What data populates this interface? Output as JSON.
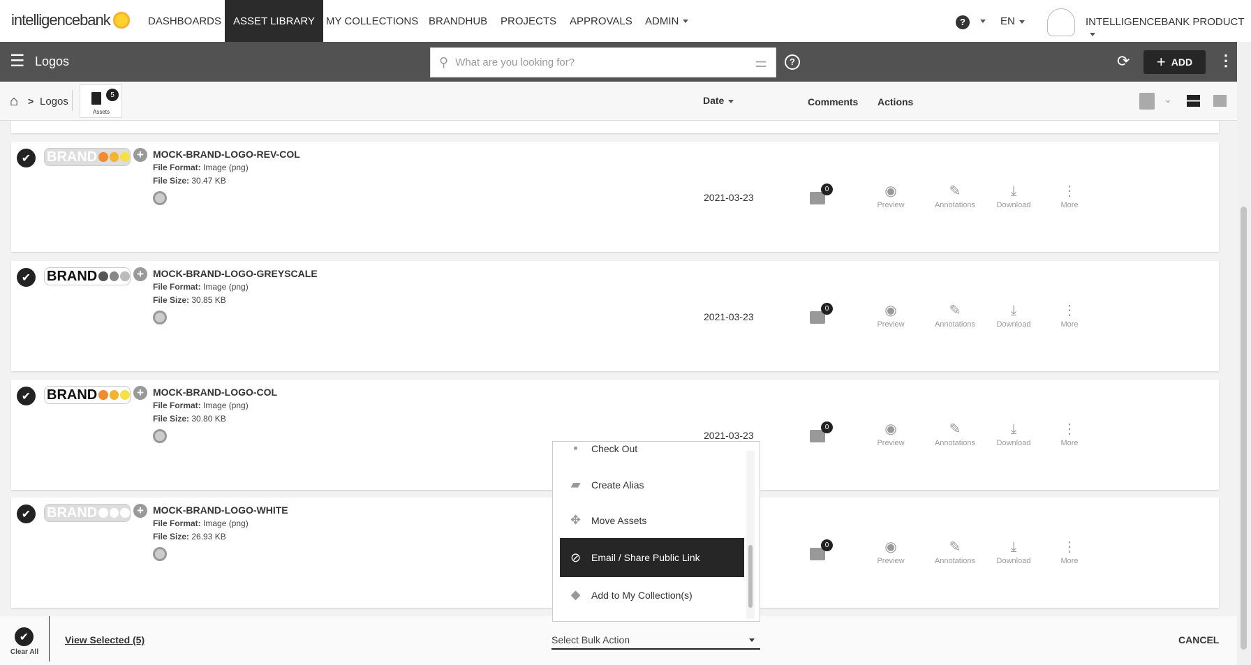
{
  "brand": {
    "name": "intelligencebank"
  },
  "topnav": {
    "items": [
      "DASHBOARDS",
      "ASSET LIBRARY",
      "MY COLLECTIONS",
      "BRANDHUB",
      "PROJECTS",
      "APPROVALS",
      "ADMIN"
    ],
    "lang": "EN",
    "user": "INTELLIGENCEBANK PRODUCT"
  },
  "toolbar": {
    "title": "Logos",
    "search_placeholder": "What are you looking for?",
    "add_label": "ADD"
  },
  "breadcrumb": {
    "current": "Logos",
    "assets_label": "Assets",
    "assets_count": "5"
  },
  "columns": {
    "date": "Date",
    "comments": "Comments",
    "actions": "Actions"
  },
  "labels": {
    "format": "File Format:",
    "size": "File Size:",
    "preview": "Preview",
    "annotations": "Annotations",
    "download": "Download",
    "more": "More"
  },
  "assets": [
    {
      "name": "MOCK-BRAND-LOGO-REV-COL",
      "format": "Image (png)",
      "size": "30.47 KB",
      "date": "2021-03-23",
      "comments": "0",
      "thumb_text": "BRAND"
    },
    {
      "name": "MOCK-BRAND-LOGO-GREYSCALE",
      "format": "Image (png)",
      "size": "30.85 KB",
      "date": "2021-03-23",
      "comments": "0",
      "thumb_text": "BRAND"
    },
    {
      "name": "MOCK-BRAND-LOGO-COL",
      "format": "Image (png)",
      "size": "30.80 KB",
      "date": "2021-03-23",
      "comments": "0",
      "thumb_text": "BRAND"
    },
    {
      "name": "MOCK-BRAND-LOGO-WHITE",
      "format": "Image (png)",
      "size": "26.93 KB",
      "date": "2021-03-23",
      "comments": "0",
      "thumb_text": "BRAND"
    }
  ],
  "bulk_menu": {
    "items": [
      "Check Out",
      "Create Alias",
      "Move Assets",
      "Email / Share Public Link",
      "Add to My Collection(s)"
    ],
    "highlighted": "Email / Share Public Link",
    "select_label": "Select Bulk Action"
  },
  "footer": {
    "clear_all": "Clear All",
    "view_selected": "View Selected (5)",
    "cancel": "CANCEL"
  }
}
